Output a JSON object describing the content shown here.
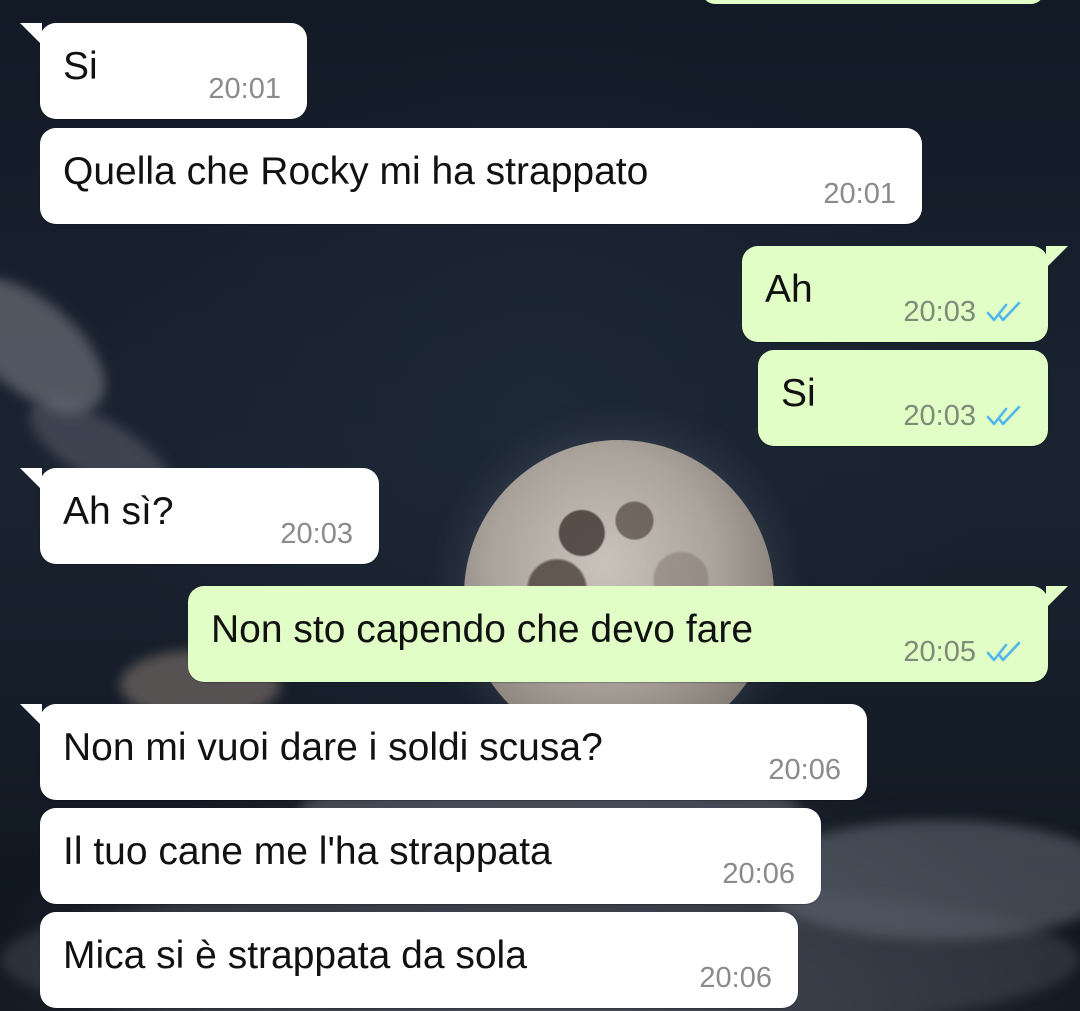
{
  "colors": {
    "incoming_bubble": "#ffffff",
    "outgoing_bubble": "#e1fec6",
    "read_ticks": "#4fb6ec",
    "timestamp": "#8b8b8b"
  },
  "messages": [
    {
      "direction": "incoming",
      "text": "Si",
      "time": "20:01"
    },
    {
      "direction": "incoming",
      "text": "Quella che Rocky mi ha strappato",
      "time": "20:01"
    },
    {
      "direction": "outgoing",
      "text": "Ah",
      "time": "20:03",
      "status": "read"
    },
    {
      "direction": "outgoing",
      "text": "Si",
      "time": "20:03",
      "status": "read"
    },
    {
      "direction": "incoming",
      "text": "Ah sì?",
      "time": "20:03"
    },
    {
      "direction": "outgoing",
      "text": "Non sto capendo che devo fare",
      "time": "20:05",
      "status": "read"
    },
    {
      "direction": "incoming",
      "text": "Non mi vuoi dare i soldi scusa?",
      "time": "20:06"
    },
    {
      "direction": "incoming",
      "text": "Il tuo cane me l'ha strappata",
      "time": "20:06"
    },
    {
      "direction": "incoming",
      "text": "Mica si è strappata da sola",
      "time": "20:06"
    }
  ]
}
